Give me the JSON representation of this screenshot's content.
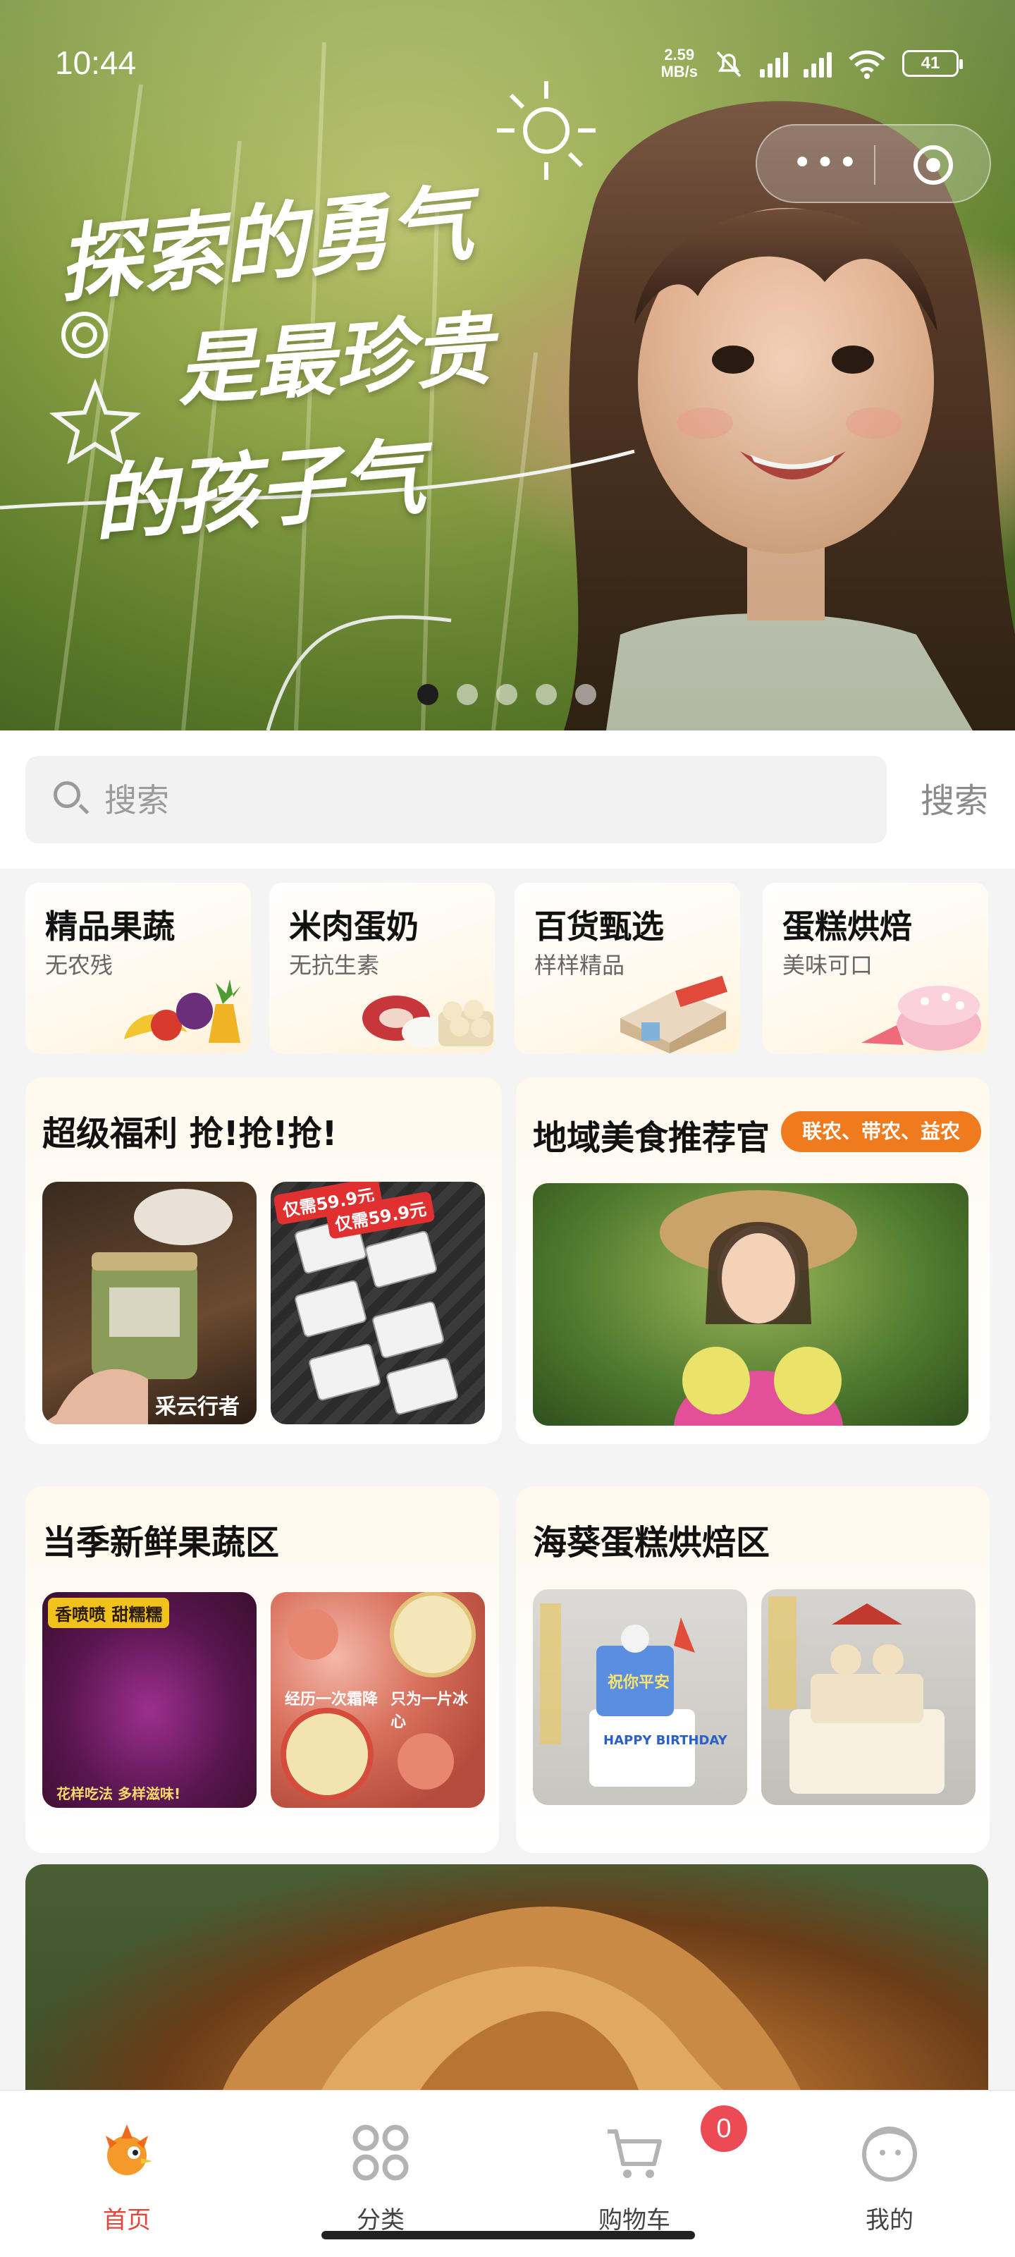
{
  "status_bar": {
    "time": "10:44",
    "net_speed_value": "2.59",
    "net_speed_unit": "MB/s",
    "battery": "41",
    "icons": [
      "mute-icon",
      "hd-signal-icon",
      "hd-signal-icon",
      "wifi-icon",
      "battery-icon"
    ]
  },
  "hero": {
    "line1": "探索的勇气",
    "line2": "是最珍贵",
    "line3": "的孩子气",
    "slides": 5,
    "active_slide": 1
  },
  "search": {
    "placeholder": "搜索",
    "button": "搜索"
  },
  "categories": [
    {
      "title": "精品果蔬",
      "subtitle": "无农残"
    },
    {
      "title": "米肉蛋奶",
      "subtitle": "无抗生素"
    },
    {
      "title": "百货甄选",
      "subtitle": "样样精品"
    },
    {
      "title": "蛋糕烘焙",
      "subtitle": "美味可口"
    }
  ],
  "promos": {
    "super_welfare": {
      "title": "超级福利 抢!抢!抢!",
      "price_tag_1": "仅需59.9元",
      "price_tag_2": "仅需59.9元",
      "brand": "采云行者"
    },
    "regional": {
      "title": "地域美食推荐官",
      "badge": "联农、带农、益农"
    },
    "seasonal": {
      "title": "当季新鲜果蔬区",
      "tag": "香喷喷 甜糯糯",
      "caption_1": "花样吃法 多样滋味!",
      "caption_2": "经历一次霜降",
      "caption_3": "只为一片冰心"
    },
    "cake": {
      "title": "海葵蛋糕烘焙区",
      "cake_text_1": "祝你平安",
      "cake_text_2": "HAPPY BIRTHDAY"
    }
  },
  "tabbar": {
    "items": [
      {
        "label": "首页",
        "icon": "home-mascot-icon"
      },
      {
        "label": "分类",
        "icon": "category-icon"
      },
      {
        "label": "购物车",
        "icon": "cart-icon"
      },
      {
        "label": "我的",
        "icon": "profile-icon"
      }
    ],
    "cart_count": "0"
  },
  "colors": {
    "accent": "#e0463a",
    "badge": "#f07b1f",
    "cart_badge": "#ec4b56"
  }
}
